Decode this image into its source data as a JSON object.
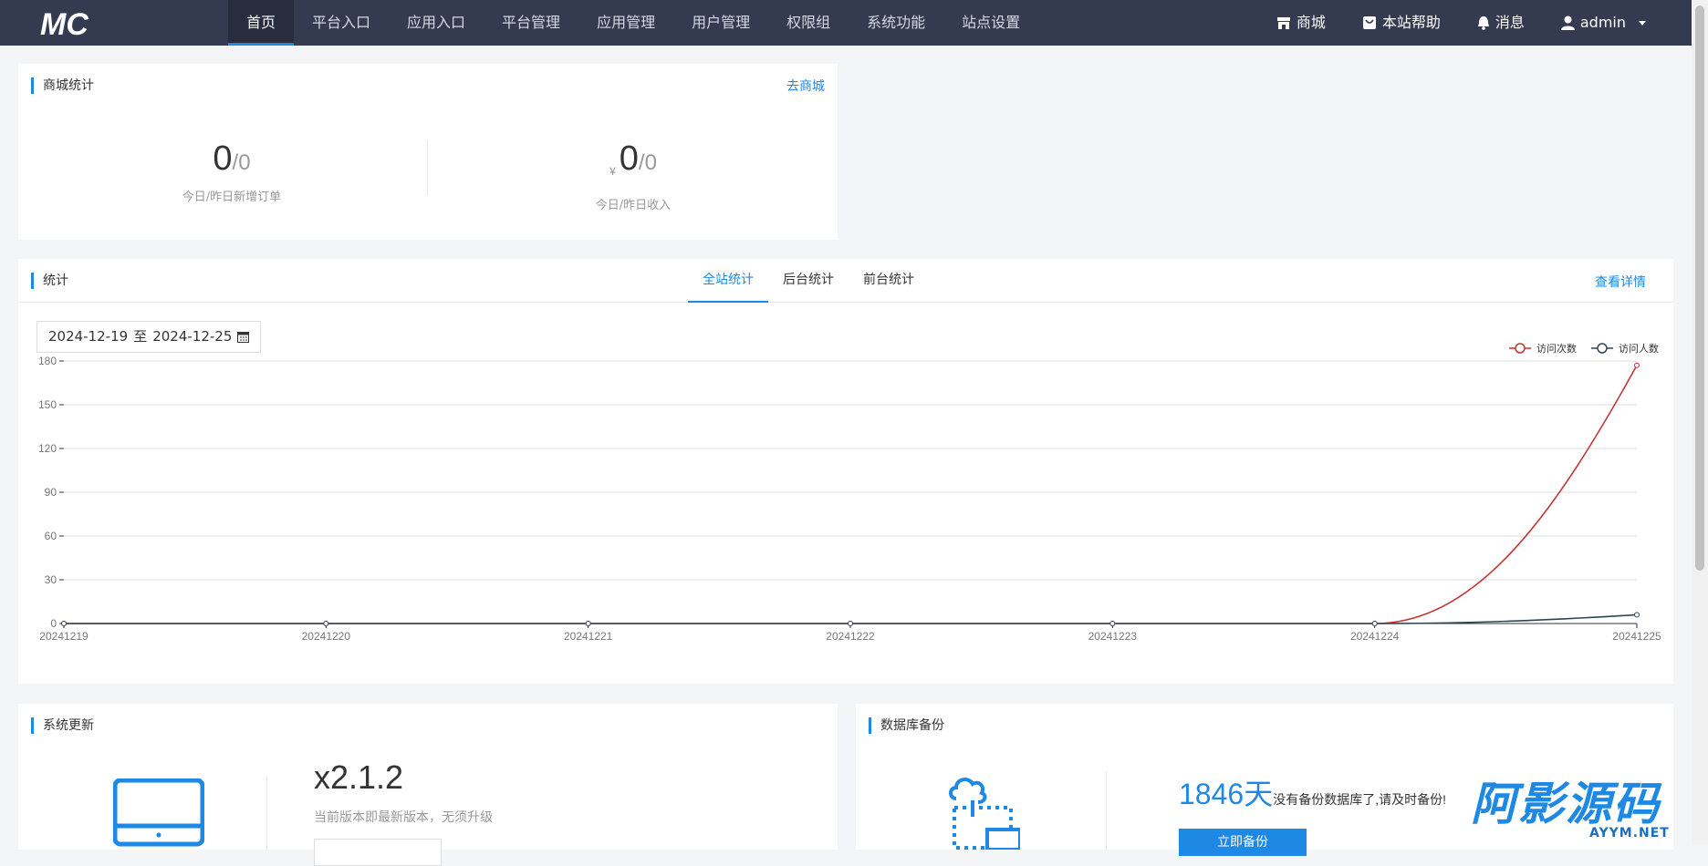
{
  "nav": {
    "logo": "MC",
    "items": [
      "首页",
      "平台入口",
      "应用入口",
      "平台管理",
      "应用管理",
      "用户管理",
      "权限组",
      "系统功能",
      "站点设置"
    ],
    "right": {
      "shop": "商城",
      "help": "本站帮助",
      "messages": "消息",
      "user": "admin"
    }
  },
  "mall_stats": {
    "title": "商城统计",
    "link": "去商城",
    "orders": {
      "today": "0",
      "yesterday": "0",
      "label": "今日/昨日新增订单"
    },
    "income": {
      "currency": "¥",
      "today": "0",
      "yesterday": "0",
      "label": "今日/昨日收入"
    }
  },
  "stats": {
    "title": "统计",
    "tabs": [
      "全站统计",
      "后台统计",
      "前台统计"
    ],
    "link": "查看详情",
    "date_from": "2024-12-19",
    "date_sep": "至",
    "date_to": "2024-12-25"
  },
  "chart_data": {
    "type": "line",
    "x": [
      "20241219",
      "20241220",
      "20241221",
      "20241222",
      "20241223",
      "20241224",
      "20241225"
    ],
    "series": [
      {
        "name": "访问次数",
        "values": [
          0,
          0,
          0,
          0,
          0,
          0,
          177
        ],
        "color": "#c23531"
      },
      {
        "name": "访问人数",
        "values": [
          0,
          0,
          0,
          0,
          0,
          0,
          6
        ],
        "color": "#2f4554"
      }
    ],
    "ylim": [
      0,
      180
    ],
    "yticks": [
      0,
      30,
      60,
      90,
      120,
      150,
      180
    ],
    "grid": true,
    "legend": "top-right"
  },
  "system_update": {
    "title": "系统更新",
    "version": "x2.1.2",
    "message": "当前版本即最新版本，无须升级"
  },
  "db_backup": {
    "title": "数据库备份",
    "days": "1846天",
    "message": "没有备份数据库了,请及时备份!",
    "button": "立即备份"
  },
  "watermark": {
    "cn": "阿影源码",
    "en": "AYYM.NET"
  }
}
